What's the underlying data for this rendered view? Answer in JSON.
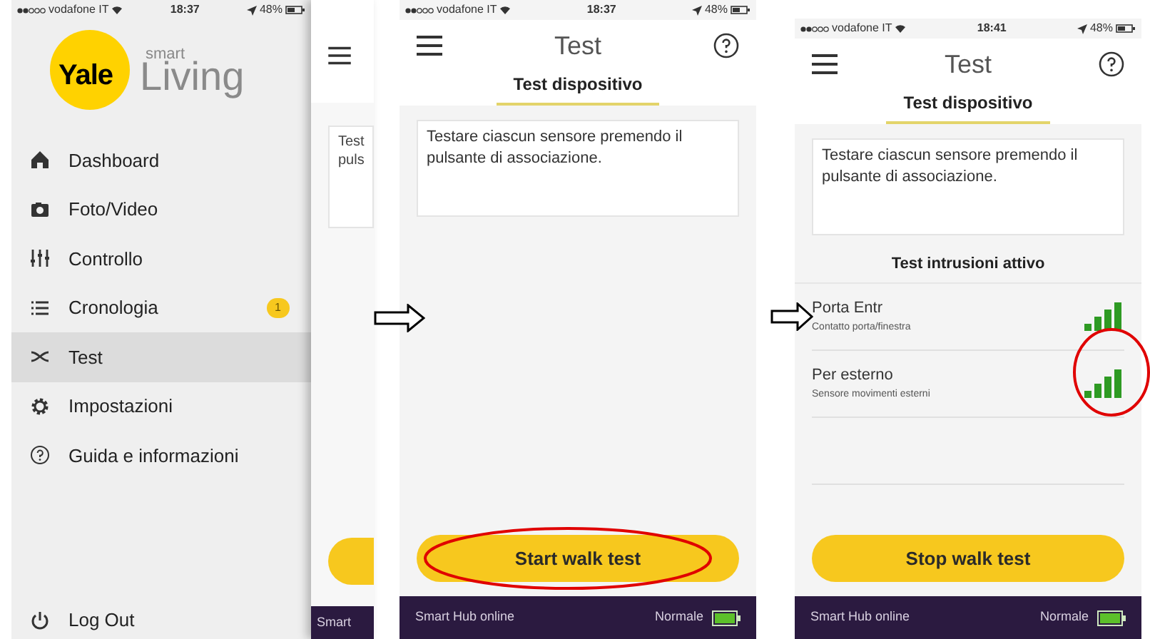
{
  "screens": [
    {
      "kind": "menu",
      "status": {
        "carrier": "vodafone IT",
        "time": "18:37",
        "battery": "48%"
      },
      "logo": {
        "brand": "Yale",
        "sub": "smart",
        "name": "Living"
      },
      "menu_items": [
        {
          "label": "Dashboard",
          "selected": false
        },
        {
          "label": "Foto/Video",
          "selected": false
        },
        {
          "label": "Controllo",
          "selected": false
        },
        {
          "label": "Cronologia",
          "selected": false,
          "badge": "1"
        },
        {
          "label": "Test",
          "selected": true
        },
        {
          "label": "Impostazioni",
          "selected": false
        },
        {
          "label": "Guida e informazioni",
          "selected": false
        }
      ],
      "logout": "Log Out",
      "peek": {
        "lines": [
          "Test",
          "puls"
        ],
        "footer": "Smart"
      }
    },
    {
      "kind": "test",
      "status": {
        "carrier": "vodafone IT",
        "time": "18:37",
        "battery": "48%"
      },
      "title": "Test",
      "tab": {
        "label": "Test dispositivo",
        "selected": true
      },
      "info": "Testare ciascun sensore premendo il pulsante di associazione.",
      "button": "Start walk test",
      "footer": {
        "hub": "Smart Hub online",
        "mode": "Normale"
      }
    },
    {
      "kind": "test",
      "status": {
        "carrier": "vodafone IT",
        "time": "18:41",
        "battery": "48%"
      },
      "title": "Test",
      "tab": {
        "label": "Test dispositivo",
        "selected": true
      },
      "info": "Testare ciascun sensore premendo il pulsante di associazione.",
      "section": "Test intrusioni attivo",
      "sensors": [
        {
          "name": "Porta Entr",
          "type": "Contatto porta/finestra"
        },
        {
          "name": "Per esterno",
          "type": "Sensore movimenti esterni"
        }
      ],
      "button": "Stop walk test",
      "footer": {
        "hub": "Smart Hub online",
        "mode": "Normale"
      }
    }
  ]
}
